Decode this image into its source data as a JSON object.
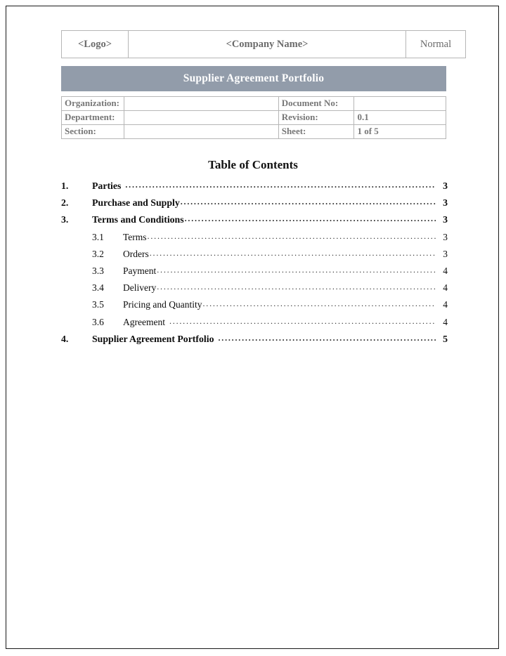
{
  "document": {
    "header": {
      "logo_placeholder": "<Logo>",
      "company_placeholder": "<Company Name>",
      "classification": "Normal"
    },
    "banner_title": "Supplier Agreement Portfolio",
    "metadata": {
      "rows": [
        {
          "left_label": "Organization:",
          "left_value": "",
          "right_label": "Document No:",
          "right_value": ""
        },
        {
          "left_label": "Department:",
          "left_value": "",
          "right_label": "Revision:",
          "right_value": "0.1"
        },
        {
          "left_label": "Section:",
          "left_value": "",
          "right_label": "Sheet:",
          "right_value": "1 of 5"
        }
      ]
    },
    "toc": {
      "heading": "Table of Contents",
      "entries": [
        {
          "number": "1.",
          "label": "Parties",
          "page": "3",
          "level": 1,
          "space_before_dots": true
        },
        {
          "number": "2.",
          "label": "Purchase and Supply",
          "page": "3",
          "level": 1,
          "space_before_dots": false
        },
        {
          "number": "3.",
          "label": "Terms and Conditions",
          "page": "3",
          "level": 1,
          "space_before_dots": false
        },
        {
          "number": "3.1",
          "label": "Terms",
          "page": "3",
          "level": 2,
          "space_before_dots": false
        },
        {
          "number": "3.2",
          "label": "Orders",
          "page": "3",
          "level": 2,
          "space_before_dots": false
        },
        {
          "number": "3.3",
          "label": "Payment",
          "page": "4",
          "level": 2,
          "space_before_dots": false
        },
        {
          "number": "3.4",
          "label": "Delivery",
          "page": "4",
          "level": 2,
          "space_before_dots": false
        },
        {
          "number": "3.5",
          "label": "Pricing and Quantity",
          "page": "4",
          "level": 2,
          "space_before_dots": false
        },
        {
          "number": "3.6",
          "label": "Agreement",
          "page": "4",
          "level": 2,
          "space_before_dots": true
        },
        {
          "number": "4.",
          "label": "Supplier Agreement Portfolio",
          "page": "5",
          "level": 1,
          "space_before_dots": true
        }
      ]
    },
    "colors": {
      "banner_background": "#929caa",
      "banner_text": "#ffffff",
      "table_border": "#b6b6b6",
      "meta_text": "#777777",
      "page_border": "#1a1a1a"
    }
  }
}
